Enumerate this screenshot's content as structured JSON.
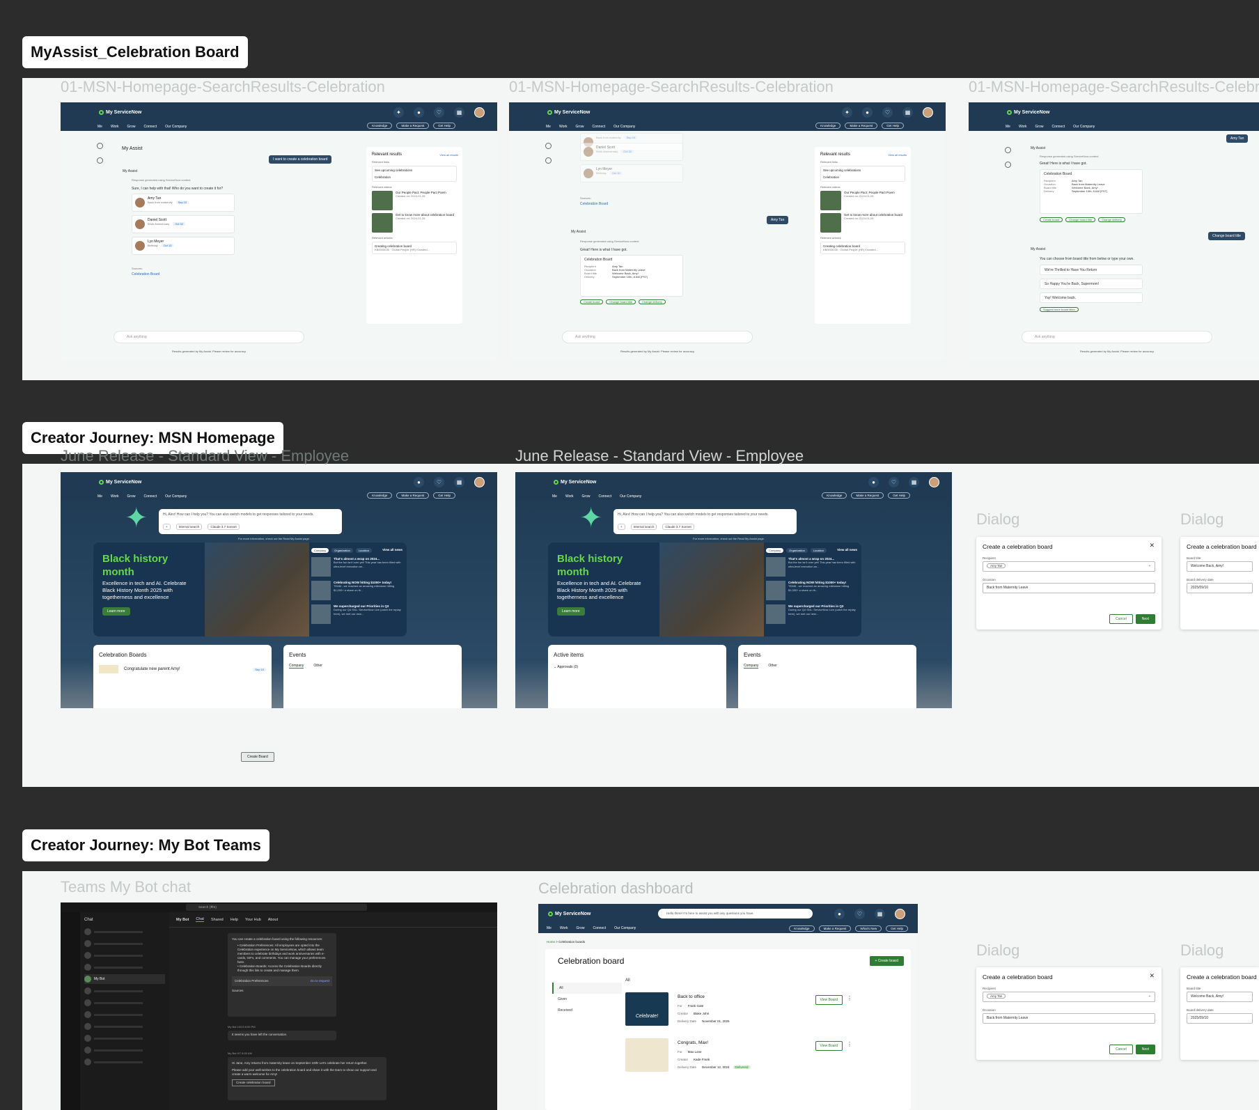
{
  "sections": [
    {
      "label": "MyAssist_Celebration Board"
    },
    {
      "label": "Creator Journey: MSN Homepage"
    },
    {
      "label": "Creator Journey: My Bot Teams"
    }
  ],
  "frame_titles": {
    "msn_search": "01-MSN-Homepage-SearchResults-Celebration",
    "june_left": "June Release - Standard View - Employee",
    "june_right": "June Release - Standard View - Employee",
    "dialog": "Dialog",
    "teams": "Teams My Bot chat",
    "dashboard": "Celebration dashboard"
  },
  "app": {
    "brand": "My ServiceNow",
    "nav": [
      "Me",
      "Work",
      "Grow",
      "Connect",
      "Our Company"
    ],
    "nav_buttons": [
      "Knowledge",
      "Make a Request",
      "Get Help"
    ],
    "nav_buttons_dash": [
      "Knowledge",
      "Make a Request",
      "What's New",
      "Get Help"
    ]
  },
  "assist": {
    "title": "My Assist",
    "user_msg": "I want to create a celebration board",
    "bot_name": "My Assist",
    "gen_note": "Response generated using ServiceNow content",
    "bot_reply": "Sure, I can help with that! Who do you want to create it for?",
    "people": [
      {
        "name": "Amy Tan",
        "reason": "Back from maternity",
        "date": "Sep 10"
      },
      {
        "name": "Daniel Scott",
        "reason": "Work Anniversary",
        "date": "Oct 02"
      },
      {
        "name": "Lyn Meyer",
        "reason": "Birthday",
        "date": "Oct 10"
      }
    ],
    "sources_label": "Sources:",
    "source_link": "Celebration Board",
    "ask_placeholder": "Ask anything",
    "disclaimer": "Results generated by My Assist. Please review for accuracy.",
    "user_reply": "Amy Tan",
    "summary_intro": "Great! Here is what I have got.",
    "summary": {
      "title": "Celebration Board",
      "rows": [
        {
          "k": "Recipient",
          "v": "Amy Tan"
        },
        {
          "k": "Occasion",
          "v": "Back from Maternity Leave"
        },
        {
          "k": "Board title",
          "v": "Welcome Back, Amy!"
        },
        {
          "k": "Delivery",
          "v": "September 10th, 8 AM (PST)"
        }
      ]
    },
    "actions": [
      "Create board",
      "Change board title",
      "Change delivery"
    ],
    "change_title_msg": "Change board title",
    "title_prompt": "You can choose from board title from below or type your own.",
    "title_options": [
      "We're Thrilled to Have You Return",
      "So Happy You're Back, Supermom!",
      "Yay! Welcome back."
    ],
    "suggest_more": "Suggest more board titles"
  },
  "related": {
    "title": "Relevant results",
    "view_all": "View all results",
    "links_label": "Relevant links",
    "links": [
      "See upcoming celebrations",
      "Celebration"
    ],
    "videos_label": "Relevant videos",
    "videos": [
      {
        "title": "Our People Pact: People Pact Poem",
        "date": "Created on: 2024-01-26"
      },
      {
        "title": "Get to know more about celebration board",
        "date": "Created on: 2024-01-26"
      }
    ],
    "articles_label": "Relevant articles",
    "article": {
      "title": "Creating celebration board",
      "meta": "KB0005035 · Global People (HR) Knowled..."
    }
  },
  "home": {
    "search_placeholder": "Hi, Alex! How can I help you? You can also switch models to get responses tailored to your needs.",
    "tool_internal": "Internal search",
    "tool_model": "Claude 3.7 Sonnet",
    "more_info": "For more information, check out the Read My Assist page.",
    "hero_title": "Black history month",
    "hero_sub": "Excellence in tech and AI. Celebrate Black History Month 2025 with togetherness and excellence",
    "hero_btn": "Learn more",
    "news_tabs": [
      "Company",
      "Organization",
      "Location"
    ],
    "news_view_all": "View all news",
    "news": [
      {
        "title": "That's almost a wrap on 2024...",
        "desc": "But the fun isn't over yet! This year has been filled with ultra-level execution an..."
      },
      {
        "title": "Celebrating NOW hitting $1000+ today!",
        "desc": "TEAM - we reached an amazing milestone hitting $1,000+ a share on th..."
      },
      {
        "title": "We supercharged our Priorities in Q3",
        "desc": "During our Q4 SNL: ServiceNow Live (catch the replay here), we met our new..."
      }
    ],
    "celebration_boards": "Celebration Boards",
    "congrats_item": "Congratulate new parent Amy!",
    "congrats_date": "Sep 10",
    "active_items": "Active items",
    "approvals": "Approvals (0)",
    "events": "Events",
    "events_tabs": [
      "Company",
      "Other"
    ],
    "create_board_btn": "Create Board"
  },
  "dialog": {
    "title": "Create a celebration board",
    "recipient_label": "Recipient",
    "recipient_value": "Amy Tan",
    "occasion_label": "Occasion",
    "occasion_value": "Back from Maternity Leave",
    "cancel": "Cancel",
    "next": "Next",
    "board_title_label": "Board title",
    "board_title_value": "Welcome Back, Amy!",
    "delivery_label": "Board delivery date",
    "delivery_value": "2025/09/10"
  },
  "teams": {
    "search": "Search (⌘E)",
    "chat_title": "Chat",
    "bot_name": "My Bot",
    "tabs": [
      "Chat",
      "Shared",
      "Help",
      "Your Hub",
      "About"
    ],
    "msg1_intro": "You can create a celebration board using the following resources:",
    "msg1_b1": "Celebration Preferences: All employees are opted into the Celebration experience on My ServiceNow, which allows team members to celebrate birthdays and work anniversaries with e-cards, GIFs, and comments. You can manage your preferences here.",
    "msg1_b2": "Celebration Boards: Access the Celebration Boards directly through this link to create and manage them.",
    "msg1_card": "Celebration Preferences",
    "msg1_goto": "Go to request",
    "sources": "Sources",
    "msg2_meta": "My Bot 10/23 8:59 PM",
    "msg2": "It seems you have left the conversation.",
    "msg3_meta": "My Bot 9/7 8:00 AM",
    "msg3_a": "Hi Jane, Amy returns from maternity leave on September 10th! Let's celebrate her return together.",
    "msg3_b": "Please add your well-wishes to the celebration board and share it with the team to show our support and create a warm welcome for Amy!",
    "msg3_btn": "Create celebration board"
  },
  "dash": {
    "search": "Hello there! I'm here to assist you with any questions you have.",
    "crumb_home": "Home",
    "crumb_page": "Celebration boards",
    "title": "Celebration board",
    "create_btn": "Create board",
    "filters": [
      "All",
      "Given",
      "Received"
    ],
    "list_heading": "All",
    "boards": [
      {
        "title": "Back to office",
        "for": "Frank Gate",
        "creator": "Blake John",
        "date": "November 01, 2025",
        "badge": "",
        "img": "Celebrate!"
      },
      {
        "title": "Congrats, Max!",
        "for": "Max Lone",
        "creator": "Kade Frank",
        "date": "December 12, 2024",
        "badge": "Delivered",
        "img": ""
      }
    ],
    "labels": {
      "for": "For",
      "creator": "Creator",
      "date": "Delivery Date"
    },
    "view_board": "View Board"
  },
  "colors": {
    "accent": "#2e7d32",
    "navy": "#1f3a52",
    "hero_green": "#67d84a"
  }
}
